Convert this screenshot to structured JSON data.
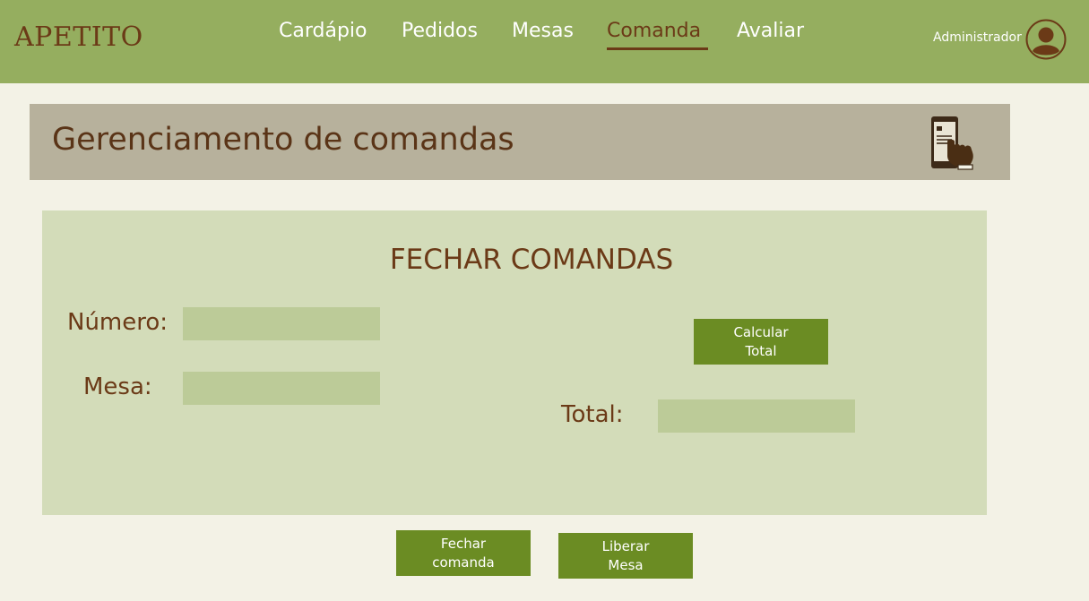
{
  "brand": "APETITO",
  "nav": {
    "items": [
      {
        "label": "Cardápio"
      },
      {
        "label": "Pedidos"
      },
      {
        "label": "Mesas"
      },
      {
        "label": "Comanda"
      },
      {
        "label": "Avaliar"
      }
    ],
    "active": "Comanda"
  },
  "user": {
    "label": "Administrador",
    "icon": "user-avatar-icon"
  },
  "page": {
    "title": "Gerenciamento de comandas",
    "icon": "phone-touch-icon"
  },
  "form": {
    "title": "FECHAR COMANDAS",
    "numero_label": "Número:",
    "numero_value": "",
    "mesa_label": "Mesa:",
    "mesa_value": "",
    "total_label": "Total:",
    "total_value": "",
    "calcular_label": "Calcular\nTotal"
  },
  "actions": {
    "fechar_label": "Fechar\ncomanda",
    "liberar_label": "Liberar\nMesa"
  },
  "colors": {
    "topbar": "#95ae5f",
    "brand_brown": "#6b3a17",
    "button_green": "#6b8c23",
    "panel": "#d3dcb9",
    "input": "#bccb98",
    "header_band": "#b7b19c",
    "background": "#f3f2e6"
  }
}
